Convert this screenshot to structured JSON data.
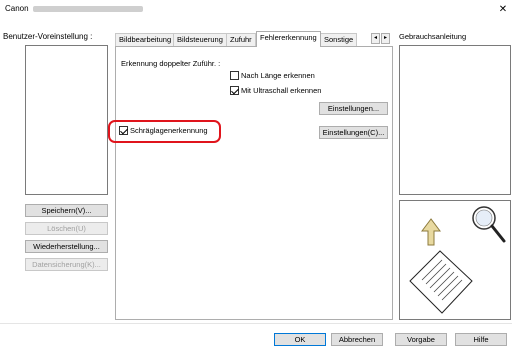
{
  "window": {
    "title": "Canon",
    "close_glyph": "✕"
  },
  "left": {
    "user_setting_label": "Benutzer-Voreinstellung :",
    "buttons": {
      "save": "Speichern(V)...",
      "delete": "Löschen(U)",
      "restore": "Wiederherstellung...",
      "backup": "Datensicherung(K)..."
    }
  },
  "tabs": [
    {
      "label": "Bildbearbeitung",
      "active": false
    },
    {
      "label": "Bildsteuerung",
      "active": false
    },
    {
      "label": "Zufuhr",
      "active": false
    },
    {
      "label": "Fehlererkennung",
      "active": true
    },
    {
      "label": "Sonstige",
      "active": false
    }
  ],
  "tab_scroll": {
    "left": "◂",
    "right": "▸"
  },
  "panel": {
    "double_feed_label": "Erkennung doppelter Zuführ. :",
    "by_length": {
      "label": "Nach Länge erkennen",
      "checked": false
    },
    "ultrasonic": {
      "label": "Mit Ultraschall erkennen",
      "checked": true
    },
    "settings1": "Einstellungen...",
    "skew": {
      "label": "Schräglagenerkennung",
      "checked": true
    },
    "settings2": "Einstellungen(C)..."
  },
  "right": {
    "manual_label": "Gebrauchsanleitung",
    "illustration": [
      "up-arrow-icon",
      "magnifier-icon",
      "document-icon"
    ]
  },
  "footer": {
    "ok": "OK",
    "cancel": "Abbrechen",
    "default": "Vorgabe",
    "help": "Hilfe"
  },
  "colors": {
    "highlight": "#e0141c",
    "arrow_fill": "#e8d9a0",
    "arrow_stroke": "#8c7a3c",
    "focus": "#0078d7"
  }
}
